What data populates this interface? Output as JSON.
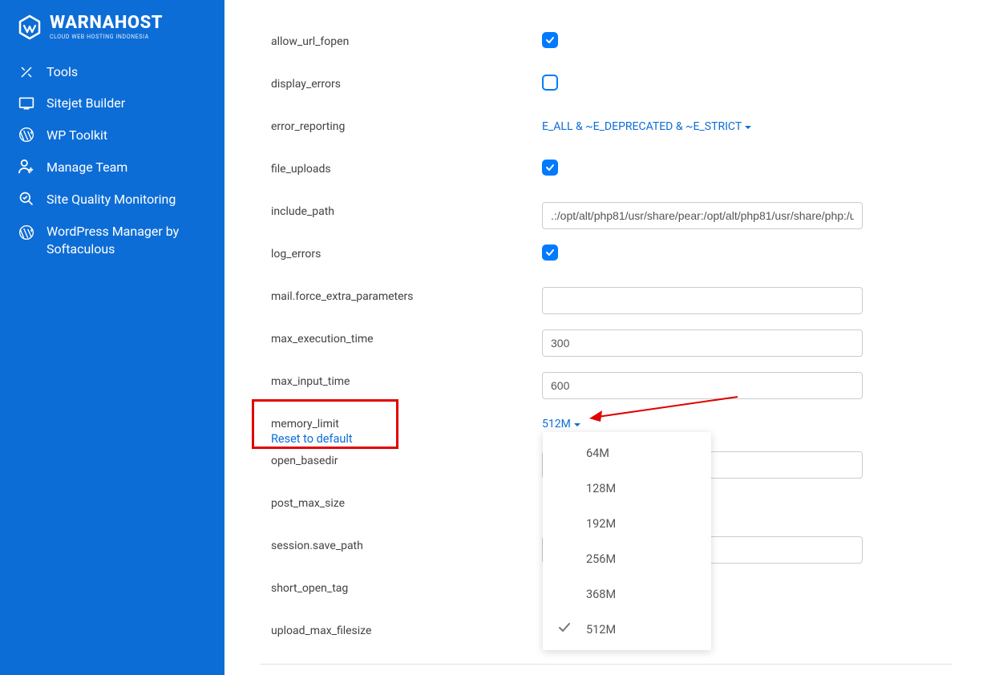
{
  "brand": {
    "name": "WARNAHOST",
    "tagline": "CLOUD WEB HOSTING INDONESIA"
  },
  "sidebar": {
    "items": [
      {
        "label": "Tools"
      },
      {
        "label": "Sitejet Builder"
      },
      {
        "label": "WP Toolkit"
      },
      {
        "label": "Manage Team"
      },
      {
        "label": "Site Quality Monitoring"
      },
      {
        "label": "WordPress Manager by Softaculous"
      }
    ]
  },
  "settings": {
    "allow_url_fopen": {
      "label": "allow_url_fopen",
      "checked": true
    },
    "display_errors": {
      "label": "display_errors",
      "checked": false
    },
    "error_reporting": {
      "label": "error_reporting",
      "value": "E_ALL & ~E_DEPRECATED & ~E_STRICT"
    },
    "file_uploads": {
      "label": "file_uploads",
      "checked": true
    },
    "include_path": {
      "label": "include_path",
      "value": ".:/opt/alt/php81/usr/share/pear:/opt/alt/php81/usr/share/php:/u"
    },
    "log_errors": {
      "label": "log_errors",
      "checked": true
    },
    "mail_force_extra_parameters": {
      "label": "mail.force_extra_parameters",
      "value": ""
    },
    "max_execution_time": {
      "label": "max_execution_time",
      "value": "300"
    },
    "max_input_time": {
      "label": "max_input_time",
      "value": "600"
    },
    "memory_limit": {
      "label": "memory_limit",
      "value": "512M",
      "reset": "Reset to default"
    },
    "open_basedir": {
      "label": "open_basedir",
      "value": ""
    },
    "post_max_size": {
      "label": "post_max_size",
      "value": ""
    },
    "session_save_path": {
      "label": "session.save_path",
      "value": ""
    },
    "short_open_tag": {
      "label": "short_open_tag"
    },
    "upload_max_filesize": {
      "label": "upload_max_filesize"
    }
  },
  "dropdown": {
    "options": [
      "64M",
      "128M",
      "192M",
      "256M",
      "368M",
      "512M"
    ],
    "selected": "512M"
  },
  "colors": {
    "sidebar": "#0d6dd6",
    "accent": "#007aff",
    "highlight": "#e10000"
  }
}
